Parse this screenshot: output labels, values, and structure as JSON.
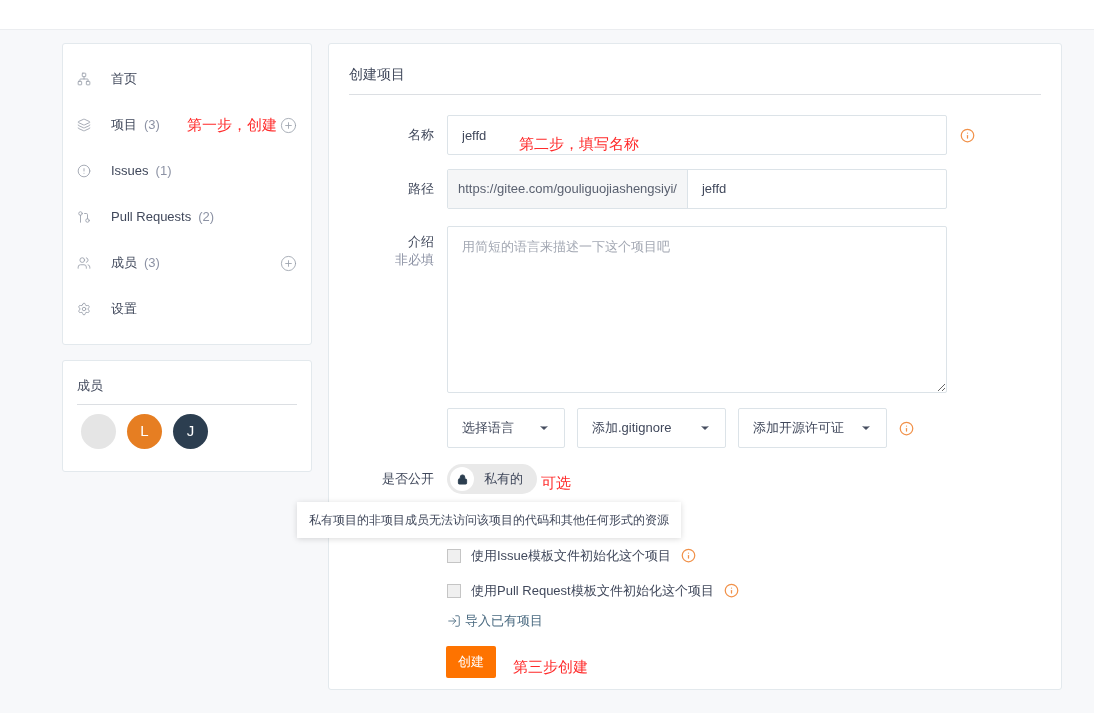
{
  "sidebar": {
    "nav": [
      {
        "kind": "home",
        "label": "首页",
        "add_button": false
      },
      {
        "kind": "project",
        "label": "项目",
        "count": "(3)",
        "add_button": true,
        "annotation": "第一步，创建"
      },
      {
        "kind": "issue",
        "label": "Issues",
        "count": "(1)",
        "add_button": false
      },
      {
        "kind": "pull",
        "label": "Pull Requests",
        "count": "(2)",
        "add_button": false
      },
      {
        "kind": "members",
        "label": "成员",
        "count": "(3)",
        "add_button": true
      },
      {
        "kind": "settings",
        "label": "设置",
        "add_button": false
      }
    ],
    "members": {
      "title": "成员",
      "avatars": [
        {
          "kind": "photo"
        },
        {
          "kind": "letter",
          "letter": "L",
          "color": "#e67e22"
        },
        {
          "kind": "letter",
          "letter": "J",
          "color": "#2c3e50"
        }
      ]
    }
  },
  "form": {
    "title": "创建项目",
    "name": {
      "label": "名称",
      "value": "jeffd",
      "annotation": "第二步，填写名称"
    },
    "path": {
      "label": "路径",
      "prefix": "https://gitee.com/gouliguojiashengsiyi/",
      "value": "jeffd"
    },
    "intro": {
      "label": "介绍",
      "hint": "非必填",
      "placeholder": "用简短的语言来描述一下这个项目吧"
    },
    "dropdowns": [
      "选择语言",
      "添加.gitignore",
      "添加开源许可证"
    ],
    "visibility": {
      "label": "是否公开",
      "public": false,
      "state_text": "私有的",
      "annotation": "可选",
      "tooltip": "私有项目的非项目成员无法访问该项目的代码和其他任何形式的资源"
    },
    "checkboxes": [
      {
        "label": "使用Issue模板文件初始化这个项目",
        "checked": false
      },
      {
        "label": "使用Pull Request模板文件初始化这个项目",
        "checked": false
      }
    ],
    "import_link": "导入已有项目",
    "submit": {
      "label": "创建",
      "annotation": "第三步创建"
    }
  }
}
